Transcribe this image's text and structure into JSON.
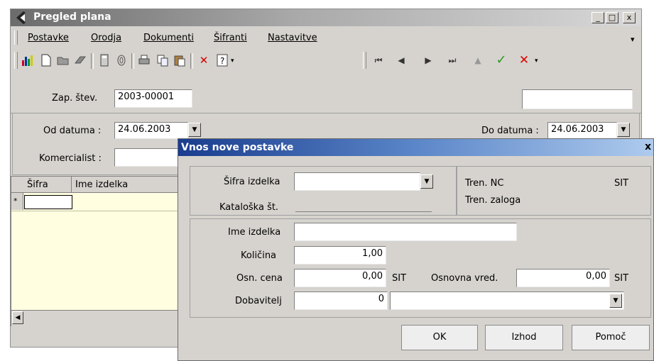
{
  "window": {
    "title": "Pregled plana",
    "minimize": "_",
    "maximize": "□",
    "close": "x"
  },
  "menu": [
    "Postavke",
    "Orodja",
    "Dokumenti",
    "Šifranti",
    "Nastavitve"
  ],
  "menu_overflow": "▾",
  "toolbar": {
    "icons": [
      "chart-icon",
      "new-doc-icon",
      "open-folder-icon",
      "eraser-icon",
      "calculator-icon",
      "fingerprint-icon",
      "print-icon",
      "copy-icon",
      "paste-icon",
      "delete-x-icon",
      "help-icon"
    ],
    "nav_icons": [
      "first-record-icon",
      "prev-record-icon",
      "next-record-icon",
      "last-record-icon",
      "up-icon",
      "confirm-check-icon",
      "cancel-x-icon"
    ]
  },
  "form": {
    "zap_label": "Zap. štev.",
    "zap_value": "2003-00001",
    "od_label": "Od datuma :",
    "od_value": "24.06.2003",
    "do_label": "Do datuma :",
    "do_value": "24.06.2003",
    "komercialist_label": "Komercialist :",
    "komercialist_value": ""
  },
  "grid": {
    "columns": [
      "Šifra",
      "Ime izdelka"
    ],
    "new_row_marker": "*"
  },
  "dialog": {
    "title": "Vnos nove postavke",
    "close": "x",
    "sifra_label": "Šifra izdelka",
    "sifra_value": "",
    "katalog_label": "Kataloška št.",
    "tren_nc_label": "Tren. NC",
    "tren_nc_unit": "SIT",
    "tren_zaloga_label": "Tren. zaloga",
    "ime_label": "Ime izdelka",
    "ime_value": "",
    "kolicina_label": "Količina",
    "kolicina_value": "1,00",
    "osn_cena_label": "Osn. cena",
    "osn_cena_value": "0,00",
    "osn_cena_unit": "SIT",
    "osnovna_vred_label": "Osnovna vred.",
    "osnovna_vred_value": "0,00",
    "osnovna_vred_unit": "SIT",
    "dobavitelj_label": "Dobavitelj",
    "dobavitelj_code": "0",
    "dobavitelj_name": "",
    "ok": "OK",
    "izhod": "Izhod",
    "pomoc": "Pomoč"
  }
}
